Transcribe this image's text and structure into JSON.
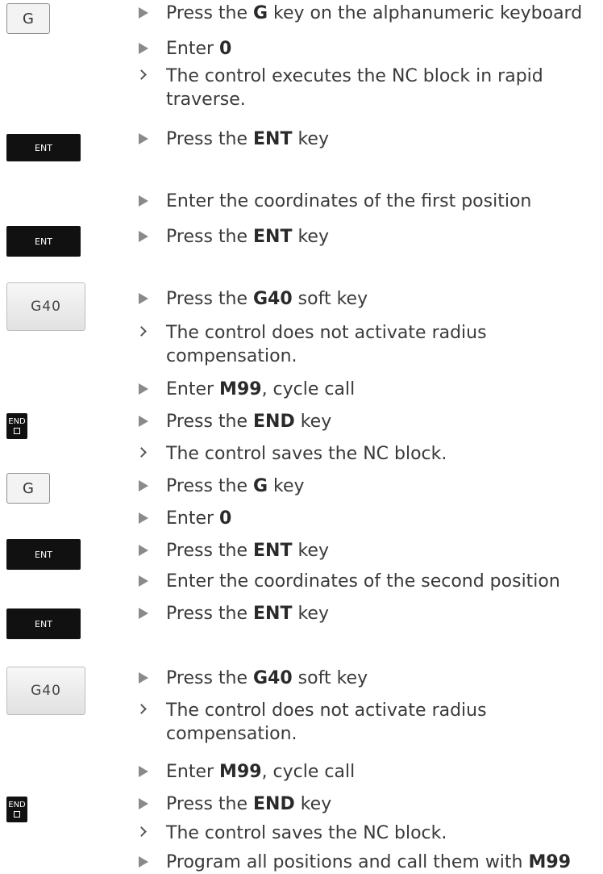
{
  "keys": {
    "g": "G",
    "ent": "ENT",
    "g40": "G40",
    "end": "END"
  },
  "steps": [
    {
      "kind": "action",
      "before": "Press the ",
      "bold": "G",
      "after": " key on the alphanumeric keyboard"
    },
    {
      "kind": "action",
      "before": "Enter ",
      "bold": "0",
      "after": ""
    },
    {
      "kind": "result",
      "before": "The control executes the NC block in rapid traverse.",
      "bold": "",
      "after": ""
    },
    {
      "kind": "action",
      "before": "Press the ",
      "bold": "ENT",
      "after": " key"
    },
    {
      "kind": "action",
      "before": "Enter the coordinates of the first position",
      "bold": "",
      "after": ""
    },
    {
      "kind": "action",
      "before": "Press the ",
      "bold": "ENT",
      "after": " key"
    },
    {
      "kind": "action",
      "before": "Press the ",
      "bold": "G40",
      "after": " soft key"
    },
    {
      "kind": "result",
      "before": "The control does not activate radius compensation.",
      "bold": "",
      "after": ""
    },
    {
      "kind": "action",
      "before": "Enter ",
      "bold": "M99",
      "after": ", cycle call"
    },
    {
      "kind": "action",
      "before": "Press the ",
      "bold": "END",
      "after": " key"
    },
    {
      "kind": "result",
      "before": "The control saves the NC block.",
      "bold": "",
      "after": ""
    },
    {
      "kind": "action",
      "before": "Press the ",
      "bold": "G",
      "after": " key"
    },
    {
      "kind": "action",
      "before": "Enter ",
      "bold": "0",
      "after": ""
    },
    {
      "kind": "action",
      "before": "Press the ",
      "bold": "ENT",
      "after": " key"
    },
    {
      "kind": "action",
      "before": "Enter the coordinates of the second position",
      "bold": "",
      "after": ""
    },
    {
      "kind": "action",
      "before": "Press the ",
      "bold": "ENT",
      "after": " key"
    },
    {
      "kind": "action",
      "before": "Press the ",
      "bold": "G40",
      "after": " soft key"
    },
    {
      "kind": "result",
      "before": "The control does not activate radius compensation.",
      "bold": "",
      "after": ""
    },
    {
      "kind": "action",
      "before": "Enter ",
      "bold": "M99",
      "after": ", cycle call"
    },
    {
      "kind": "action",
      "before": "Press the ",
      "bold": "END",
      "after": " key"
    },
    {
      "kind": "result",
      "before": "The control saves the NC block.",
      "bold": "",
      "after": ""
    },
    {
      "kind": "action",
      "before": "Program all positions and call them with ",
      "bold": "M99",
      "after": ""
    }
  ]
}
